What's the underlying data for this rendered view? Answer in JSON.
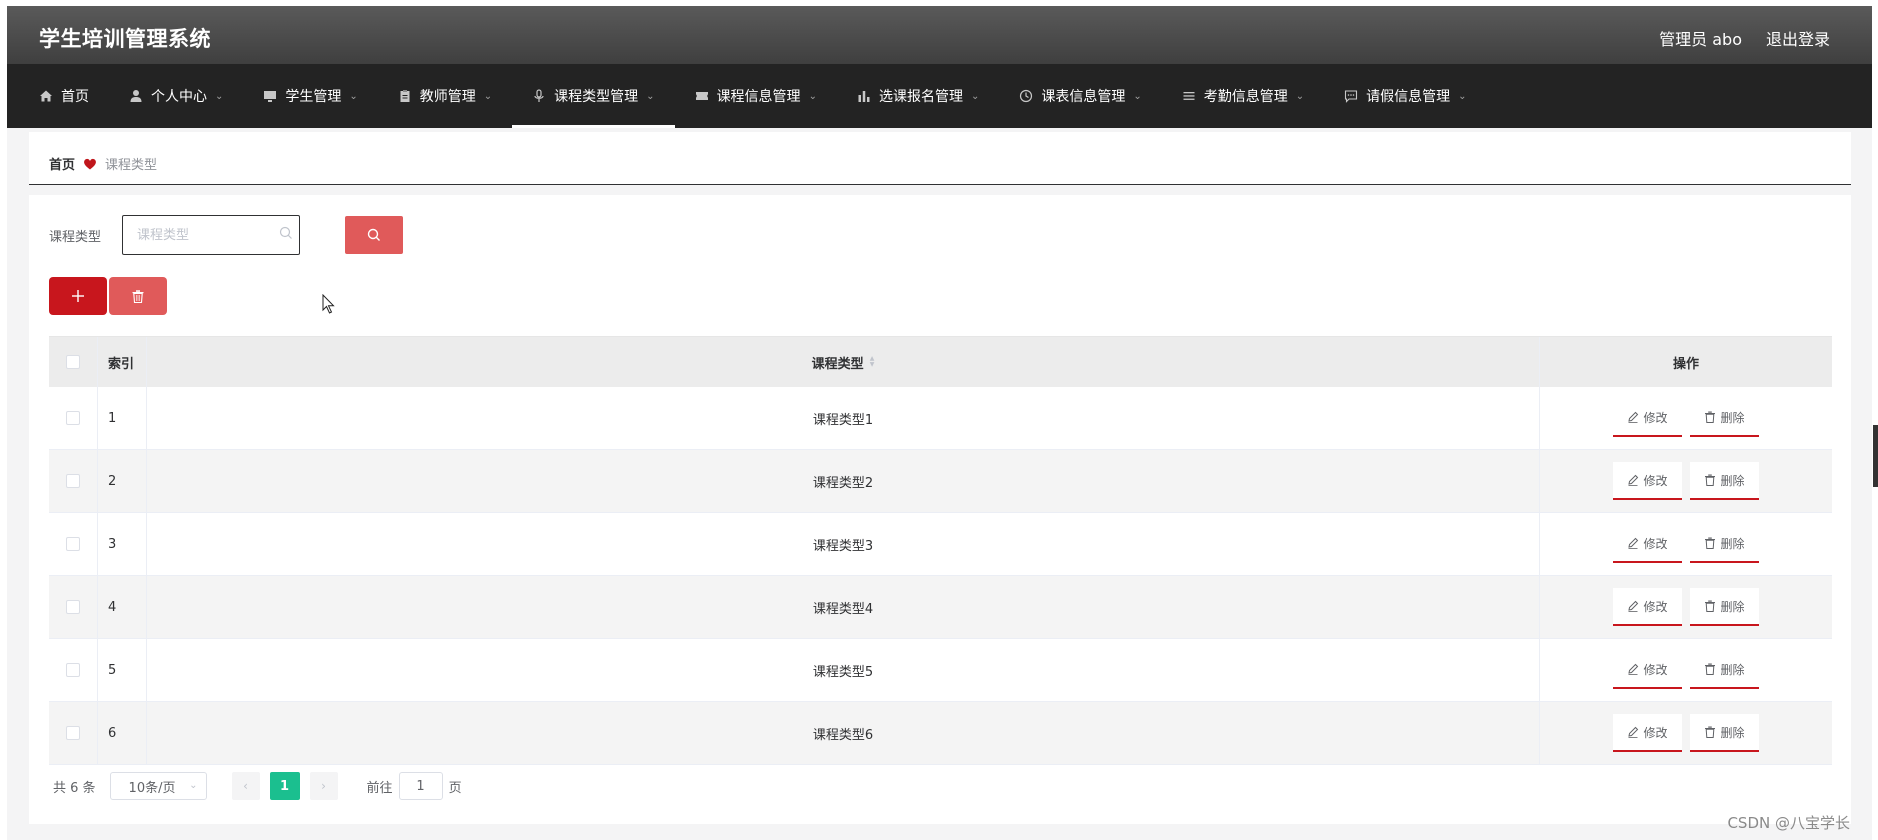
{
  "app": {
    "title": "学生培训管理系统",
    "user_label": "管理员 abo",
    "logout_label": "退出登录"
  },
  "nav": {
    "items": [
      {
        "label": "首页",
        "icon": "home-icon",
        "has_dropdown": false
      },
      {
        "label": "个人中心",
        "icon": "user-icon",
        "has_dropdown": true
      },
      {
        "label": "学生管理",
        "icon": "monitor-icon",
        "has_dropdown": true
      },
      {
        "label": "教师管理",
        "icon": "clipboard-icon",
        "has_dropdown": true
      },
      {
        "label": "课程类型管理",
        "icon": "microphone-icon",
        "has_dropdown": true,
        "active": true
      },
      {
        "label": "课程信息管理",
        "icon": "ticket-icon",
        "has_dropdown": true
      },
      {
        "label": "选课报名管理",
        "icon": "bar-chart-icon",
        "has_dropdown": true
      },
      {
        "label": "课表信息管理",
        "icon": "clock-icon",
        "has_dropdown": true
      },
      {
        "label": "考勤信息管理",
        "icon": "list-icon",
        "has_dropdown": true
      },
      {
        "label": "请假信息管理",
        "icon": "chat-icon",
        "has_dropdown": true
      }
    ]
  },
  "breadcrumb": {
    "home": "首页",
    "current": "课程类型"
  },
  "search": {
    "label": "课程类型",
    "placeholder": "课程类型",
    "value": ""
  },
  "table": {
    "headers": {
      "index": "索引",
      "type": "课程类型",
      "actions": "操作"
    },
    "rows": [
      {
        "index": "1",
        "type": "课程类型1",
        "edit": "修改",
        "delete": "删除"
      },
      {
        "index": "2",
        "type": "课程类型2",
        "edit": "修改",
        "delete": "删除"
      },
      {
        "index": "3",
        "type": "课程类型3",
        "edit": "修改",
        "delete": "删除"
      },
      {
        "index": "4",
        "type": "课程类型4",
        "edit": "修改",
        "delete": "删除"
      },
      {
        "index": "5",
        "type": "课程类型5",
        "edit": "修改",
        "delete": "删除"
      },
      {
        "index": "6",
        "type": "课程类型6",
        "edit": "修改",
        "delete": "删除"
      }
    ]
  },
  "pagination": {
    "total": "共 6 条",
    "page_size": "10条/页",
    "current_page": "1",
    "goto_prefix": "前往",
    "goto_value": "1",
    "goto_suffix": "页"
  },
  "colors": {
    "header_bg": "#4a4a4a",
    "nav_bg": "#232323",
    "primary_red": "#c8161d",
    "light_red": "#e05a5a",
    "page_active": "#1bbf8f"
  },
  "watermark": "CSDN @八宝学长"
}
